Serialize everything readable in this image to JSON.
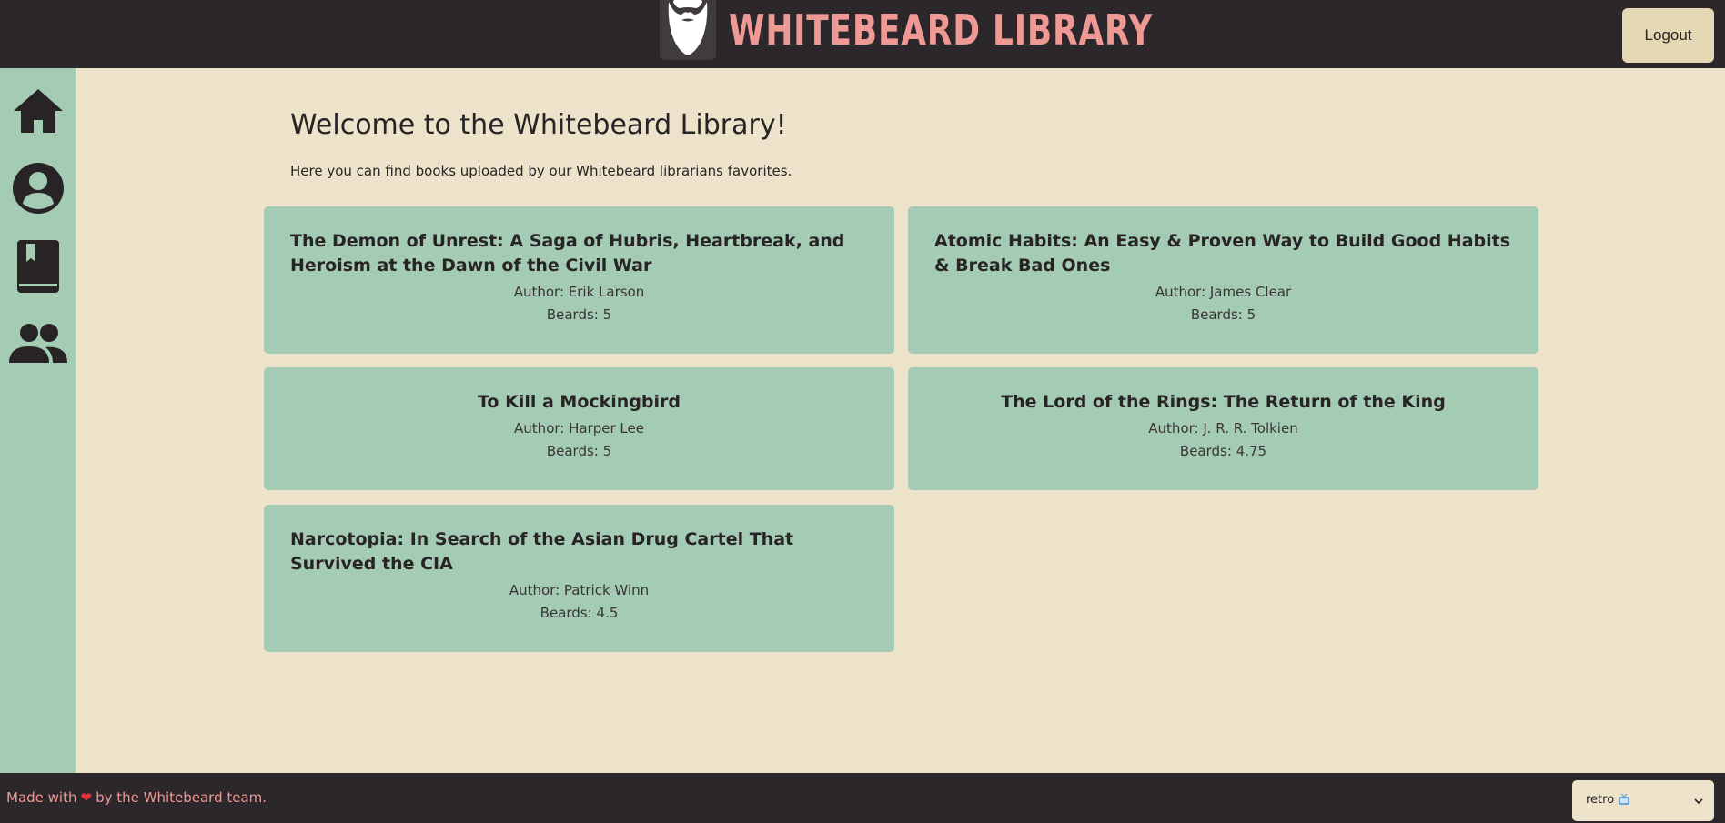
{
  "header": {
    "title": "WHITEBEARD LIBRARY",
    "logo_icon": "beard-icon",
    "logout_label": "Logout"
  },
  "sidebar": {
    "items": [
      {
        "name": "home",
        "icon": "home-icon"
      },
      {
        "name": "profile",
        "icon": "user-icon"
      },
      {
        "name": "books",
        "icon": "book-icon"
      },
      {
        "name": "users",
        "icon": "group-icon"
      }
    ]
  },
  "main": {
    "welcome": "Welcome to the Whitebeard Library!",
    "subtitle": "Here you can find books uploaded by our Whitebeard librarians favorites.",
    "books": [
      {
        "title": "The Demon of Unrest: A Saga of Hubris, Heartbreak, and Heroism at the Dawn of the Civil War",
        "author": "Author: Erik Larson",
        "beards": "Beards: 5"
      },
      {
        "title": "Atomic Habits: An Easy & Proven Way to Build Good Habits & Break Bad Ones",
        "author": "Author: James Clear",
        "beards": "Beards: 5"
      },
      {
        "title": "To Kill a Mockingbird",
        "author": "Author: Harper Lee",
        "beards": "Beards: 5"
      },
      {
        "title": "The Lord of the Rings: The Return of the King",
        "author": "Author: J. R. R. Tolkien",
        "beards": "Beards: 4.75"
      },
      {
        "title": "Narcotopia: In Search of the Asian Drug Cartel That Survived the CIA",
        "author": "Author: Patrick Winn",
        "beards": "Beards: 4.5"
      }
    ]
  },
  "footer": {
    "made_with": "Made with",
    "by_team": "by the Whitebeard team.",
    "theme_value": "retro",
    "theme_icon": "tv-icon"
  },
  "colors": {
    "background": "#ece3ca",
    "accent": "#a4cbb4",
    "dark": "#2c272b",
    "brand": "#ef9995"
  }
}
